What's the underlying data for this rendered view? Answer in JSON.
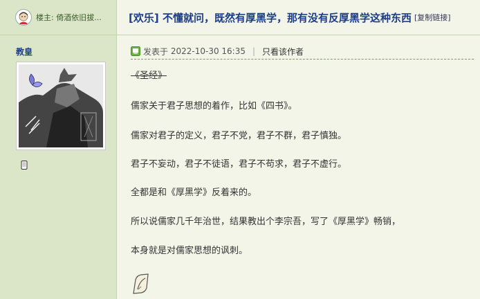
{
  "header": {
    "op_prefix": "楼主:",
    "op_name": "倚酒依旧拔...",
    "thread_category": "[欢乐]",
    "thread_title": "不懂就问，既然有厚黑学，那有没有反厚黑学这种东西",
    "copy_link_label": "[复制链接]"
  },
  "post": {
    "author": "教皇",
    "posted_prefix": "发表于",
    "posted_time": "2022-10-30 16:35",
    "separator": "|",
    "only_author_label": "只看该作者",
    "lines": [
      "《圣经》",
      "儒家关于君子思想的着作，比如《四书》。",
      "儒家对君子的定义，君子不党，君子不群，君子慎独。",
      "君子不妄动，君子不徒语，君子不苟求，君子不虚行。",
      "全都是和《厚黑学》反着来的。",
      "所以说儒家几千年治世，结果教出个李宗吾，写了《厚黑学》畅销，",
      "本身就是对儒家思想的讽刺。"
    ]
  },
  "icons": {
    "op_avatar": "user-avatar-icon",
    "online": "online-status-icon",
    "mobile": "mobile-phone-icon",
    "signature": "signature-quill-icon"
  },
  "colors": {
    "sidebar_bg": "#dbe6c8",
    "main_bg": "#f3f5e9",
    "title_blue": "#1c3e8a",
    "online_green": "#6db33f"
  }
}
